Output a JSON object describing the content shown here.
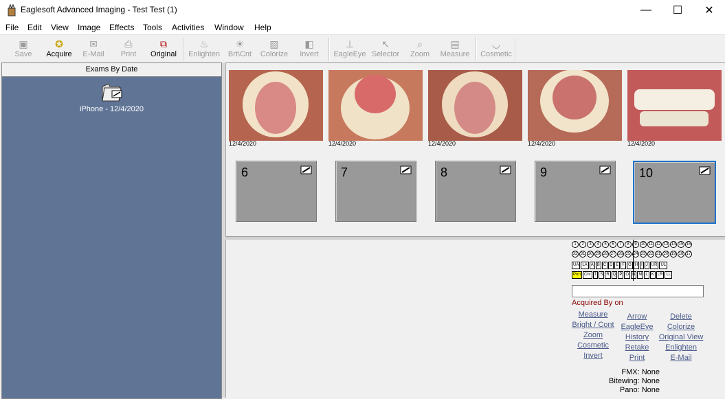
{
  "window": {
    "title": "Eaglesoft Advanced Imaging - Test Test (1)",
    "minimize": "—",
    "maximize": "☐",
    "close": "✕"
  },
  "menu": [
    "File",
    "Edit",
    "View",
    "Image",
    "Effects",
    "Tools",
    "Activities",
    "Window",
    "Help"
  ],
  "menu_accel": [
    "F",
    "E",
    "V",
    "I",
    "c",
    "T",
    "A",
    "W",
    "H"
  ],
  "toolbar": {
    "save": "Save",
    "acquire": "Acquire",
    "email": "E-Mail",
    "print": "Print",
    "original": "Original",
    "enlighten": "Enlighten",
    "brtcnt": "Brt\\Cnt",
    "colorize": "Colorize",
    "invert": "Invert",
    "eagleeye": "EagleEye",
    "selector": "Selector",
    "zoom": "Zoom",
    "measure": "Measure",
    "cosmetic": "Cosmetic"
  },
  "exams": {
    "header": "Exams By Date",
    "item": "iPhone - 12/4/2020"
  },
  "photos": [
    {
      "date": "12/4/2020",
      "color": "#b5654f"
    },
    {
      "date": "12/4/2020",
      "color": "#c7795e"
    },
    {
      "date": "12/4/2020",
      "color": "#a85b49"
    },
    {
      "date": "12/4/2020",
      "color": "#b66a58"
    },
    {
      "date": "12/4/2020",
      "color": "#c25a5a"
    }
  ],
  "slots": [
    "6",
    "7",
    "8",
    "9",
    "10"
  ],
  "chart": {
    "upper": [
      "1",
      "2",
      "3",
      "4",
      "5",
      "6",
      "7",
      "8",
      "9",
      "10",
      "11",
      "12",
      "13",
      "14",
      "15",
      "16"
    ],
    "lower": [
      "32",
      "31",
      "30",
      "29",
      "28",
      "27",
      "26",
      "25",
      "24",
      "23",
      "22",
      "21",
      "20",
      "19",
      "18",
      "17"
    ],
    "row3": [
      "UA",
      "LA",
      "A",
      "B",
      "C",
      "D",
      "E",
      "F",
      "G",
      "H",
      "I",
      "J",
      "UR",
      "UL"
    ],
    "row4": [
      "Prm",
      "Chr",
      "T",
      "S",
      "R",
      "Q",
      "P",
      "O",
      "N",
      "M",
      "L",
      "K",
      "LR",
      "LL"
    ]
  },
  "acquired": "Acquired By  on",
  "links": {
    "col1": [
      "Measure",
      "Bright / Cont",
      "Zoom",
      "Cosmetic",
      "Invert"
    ],
    "col2": [
      "Arrow",
      "EagleEye",
      "History",
      "Retake",
      "Print"
    ],
    "col3": [
      "Delete",
      "Colorize",
      "Original View",
      "Enlighten",
      "E-Mail"
    ]
  },
  "info": {
    "fmx": "FMX: None",
    "bitewing": "Bitewing: None",
    "pano": "Pano: None"
  }
}
